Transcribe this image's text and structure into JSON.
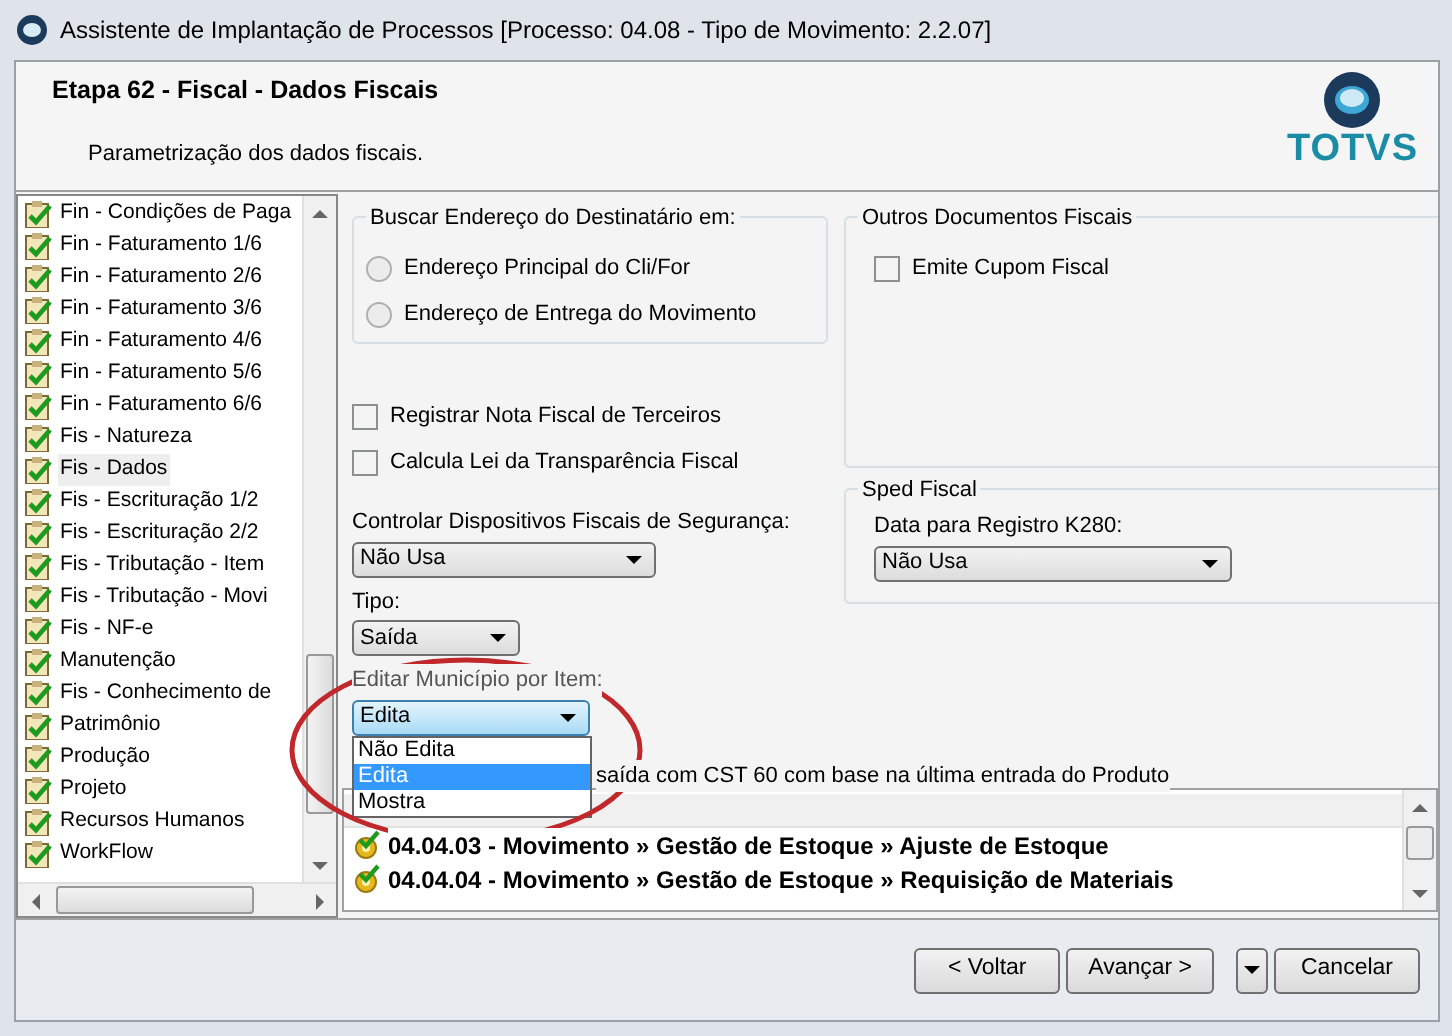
{
  "window": {
    "title": "Assistente de Implantação de Processos [Processo: 04.08 - Tipo de Movimento: 2.2.07]"
  },
  "header": {
    "title": "Etapa 62 - Fiscal - Dados Fiscais",
    "subtitle": "Parametrização dos dados fiscais.",
    "logo": "TOTVS"
  },
  "steps": [
    {
      "label": "Fin - Condições de Paga",
      "selected": false
    },
    {
      "label": "Fin - Faturamento 1/6",
      "selected": false
    },
    {
      "label": "Fin - Faturamento 2/6",
      "selected": false
    },
    {
      "label": "Fin - Faturamento 3/6",
      "selected": false
    },
    {
      "label": "Fin - Faturamento 4/6",
      "selected": false
    },
    {
      "label": "Fin - Faturamento 5/6",
      "selected": false
    },
    {
      "label": "Fin - Faturamento 6/6",
      "selected": false
    },
    {
      "label": "Fis - Natureza",
      "selected": false
    },
    {
      "label": "Fis - Dados",
      "selected": true
    },
    {
      "label": "Fis - Escrituração 1/2",
      "selected": false
    },
    {
      "label": "Fis - Escrituração 2/2",
      "selected": false
    },
    {
      "label": "Fis - Tributação - Item",
      "selected": false
    },
    {
      "label": "Fis - Tributação - Movi",
      "selected": false
    },
    {
      "label": "Fis - NF-e",
      "selected": false
    },
    {
      "label": "Manutenção",
      "selected": false
    },
    {
      "label": "Fis - Conhecimento de",
      "selected": false
    },
    {
      "label": "Patrimônio",
      "selected": false
    },
    {
      "label": "Produção",
      "selected": false
    },
    {
      "label": "Projeto",
      "selected": false
    },
    {
      "label": "Recursos Humanos",
      "selected": false
    },
    {
      "label": "WorkFlow",
      "selected": false
    }
  ],
  "address_group": {
    "title": "Buscar Endereço do Destinatário em:",
    "options": [
      {
        "label": "Endereço Principal do Cli/For",
        "selected": false
      },
      {
        "label": "Endereço de Entrega do Movimento",
        "selected": false
      }
    ]
  },
  "checkboxes": [
    {
      "label": "Registrar Nota Fiscal de Terceiros",
      "checked": false
    },
    {
      "label": "Calcula Lei da Transparência Fiscal",
      "checked": false
    }
  ],
  "other_docs": {
    "title": "Outros Documentos Fiscais",
    "checkboxes": [
      {
        "label": "Emite Cupom Fiscal",
        "checked": false
      }
    ]
  },
  "sped": {
    "title": "Sped Fiscal",
    "field": {
      "label": "Data para Registro K280:",
      "value": "Não Usa"
    }
  },
  "fields": [
    {
      "label": "Controlar Dispositivos Fiscais de Segurança:",
      "value": "Não Usa",
      "expanded": false
    },
    {
      "label": "Tipo:",
      "value": "Saída",
      "expanded": false
    },
    {
      "label": "Editar Município por Item:",
      "value": "Edita",
      "expanded": true,
      "options": [
        {
          "label": "Não Edita",
          "selected": false
        },
        {
          "label": "Edita",
          "selected": true
        },
        {
          "label": "Mostra",
          "selected": false
        }
      ]
    }
  ],
  "partial_text": "saída com CST 60 com base na última entrada do Produto",
  "related": {
    "rows": [
      "04.04.03 - Movimento » Gestão de Estoque » Ajuste de Estoque",
      "04.04.04 - Movimento » Gestão de Estoque » Requisição de Materiais"
    ]
  },
  "buttons": [
    {
      "kind": "button",
      "label": "< Voltar"
    },
    {
      "kind": "button",
      "label": "Avançar >"
    },
    {
      "kind": "caret"
    },
    {
      "kind": "button",
      "label": "Cancelar"
    }
  ]
}
